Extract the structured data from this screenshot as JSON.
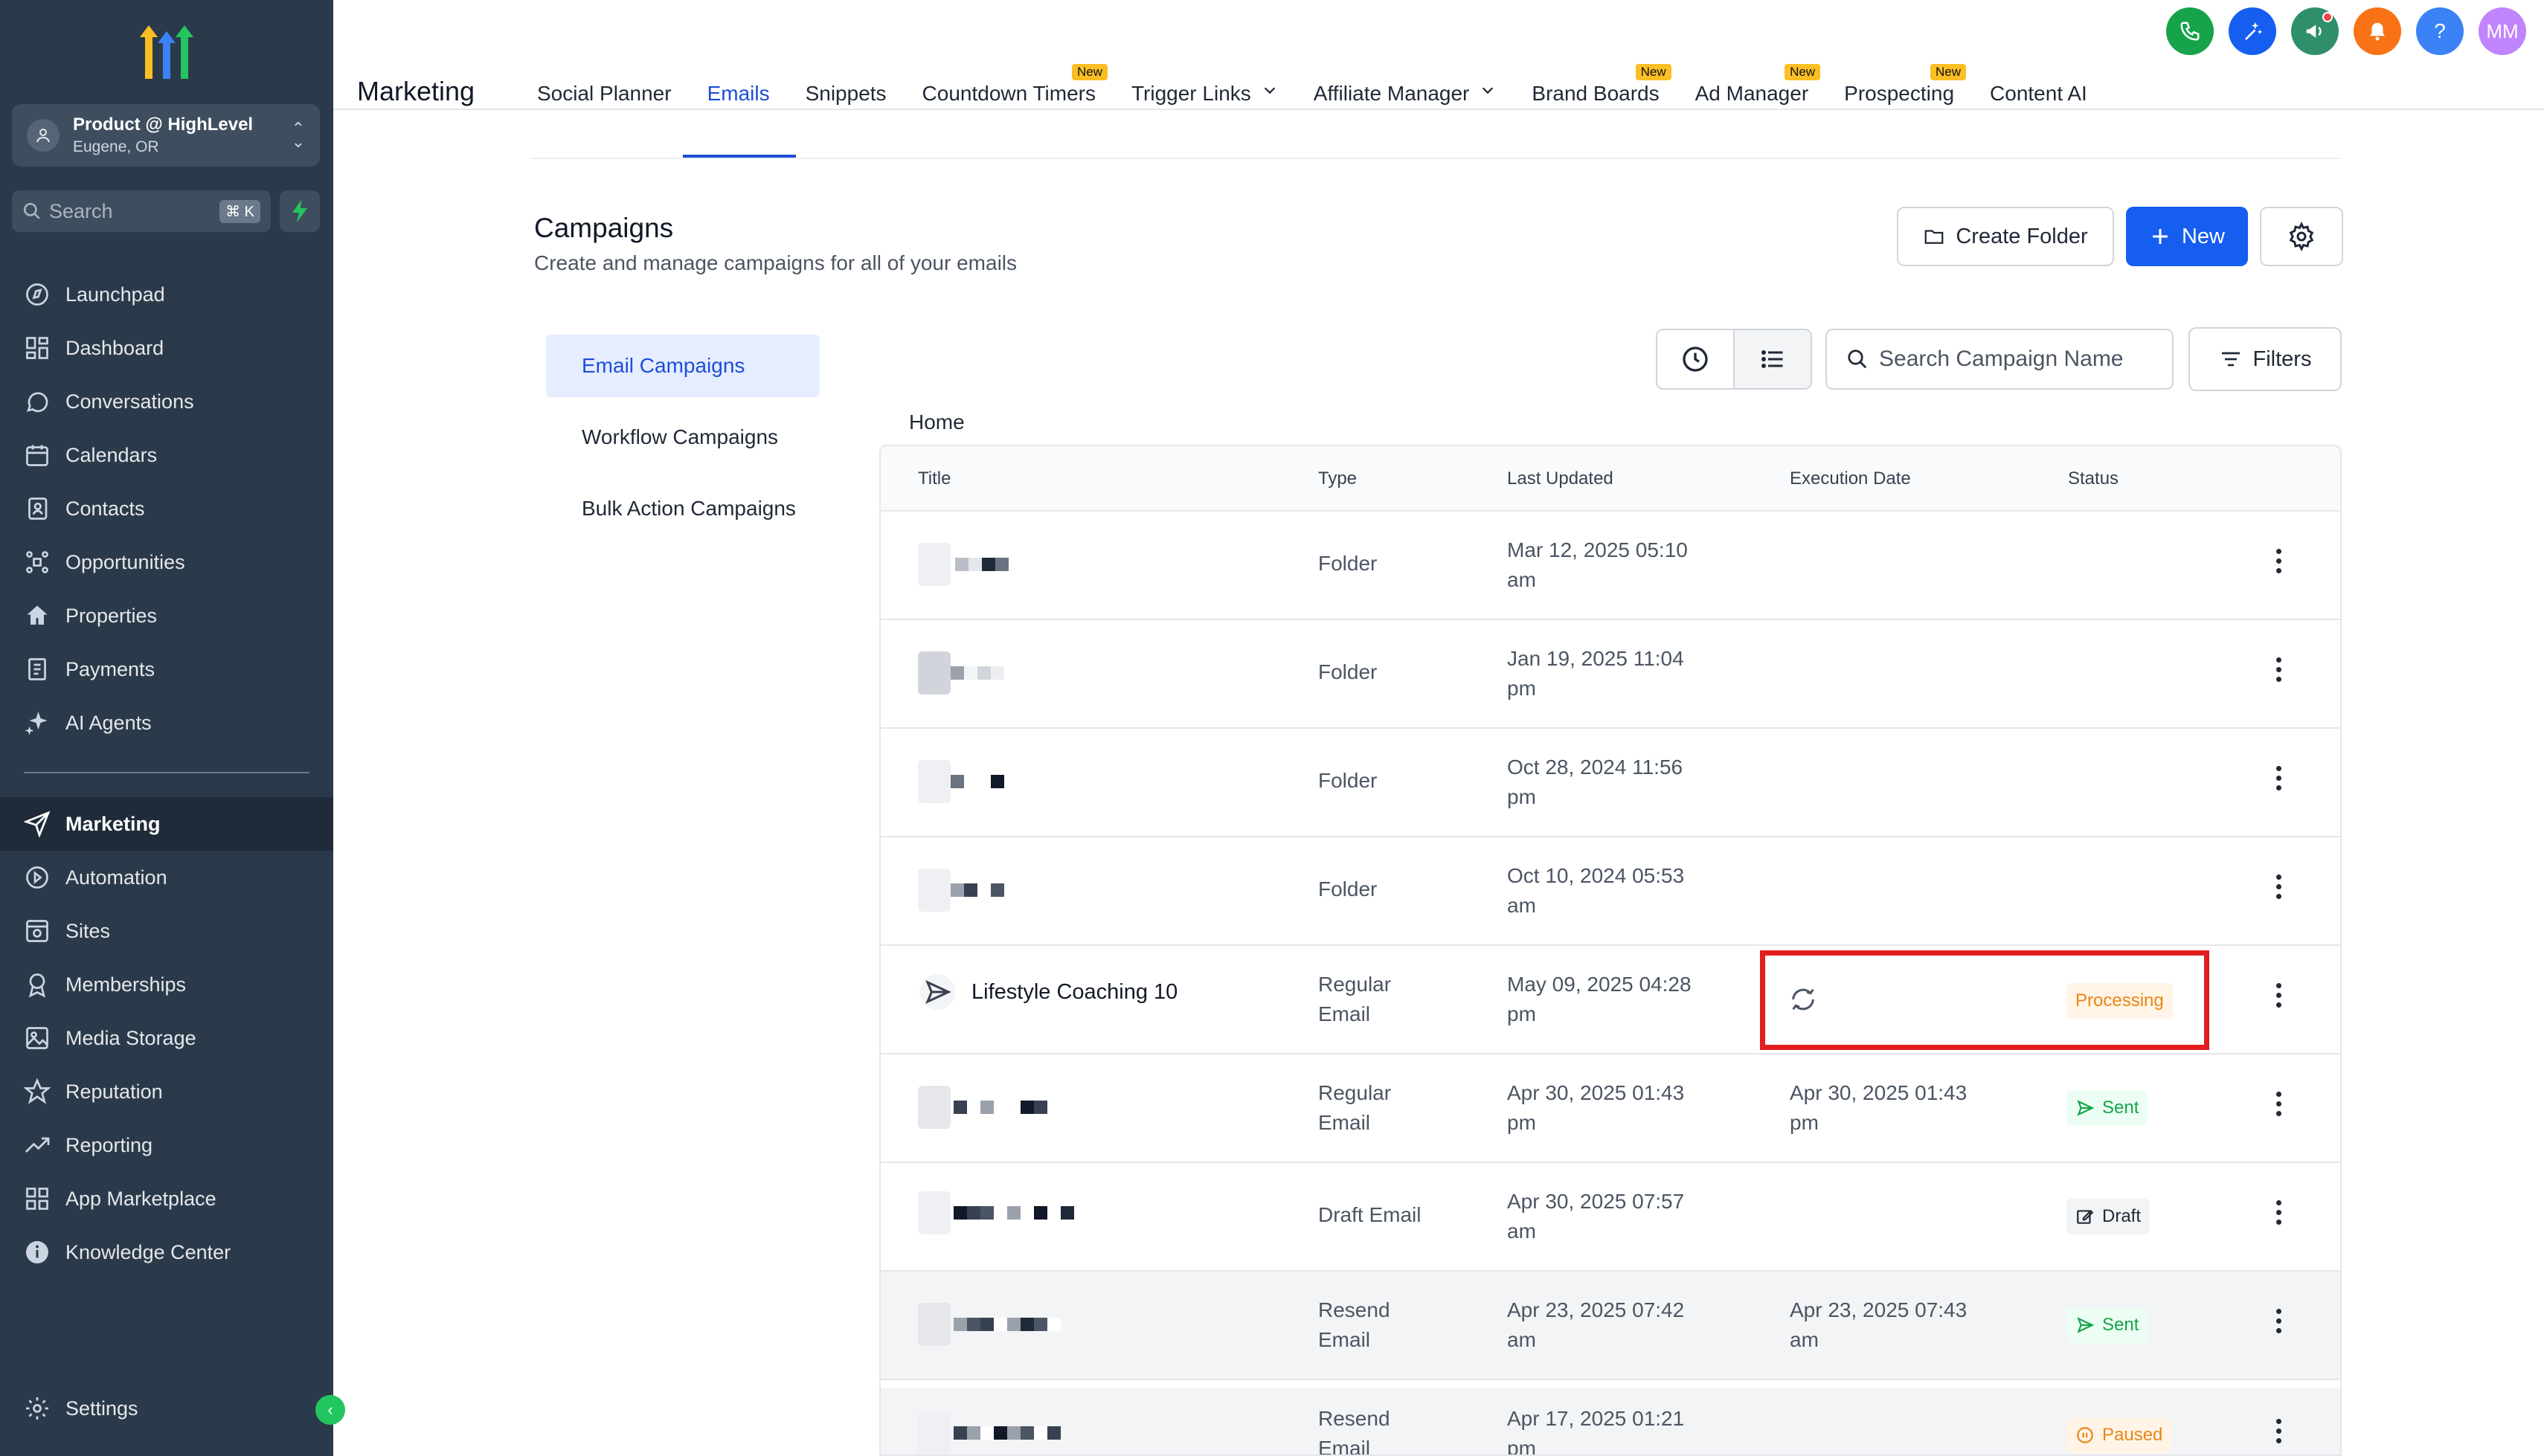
{
  "sidebar": {
    "account": {
      "name": "Product @ HighLevel",
      "location": "Eugene, OR"
    },
    "search": {
      "placeholder": "Search",
      "shortcut": "⌘ K"
    },
    "items": [
      {
        "label": "Launchpad",
        "icon": "launchpad-icon"
      },
      {
        "label": "Dashboard",
        "icon": "dashboard-icon"
      },
      {
        "label": "Conversations",
        "icon": "chat-icon"
      },
      {
        "label": "Calendars",
        "icon": "calendar-icon"
      },
      {
        "label": "Contacts",
        "icon": "contacts-icon"
      },
      {
        "label": "Opportunities",
        "icon": "opportunities-icon"
      },
      {
        "label": "Properties",
        "icon": "home-icon"
      },
      {
        "label": "Payments",
        "icon": "payments-icon"
      },
      {
        "label": "AI Agents",
        "icon": "sparkle-icon"
      }
    ],
    "items2": [
      {
        "label": "Marketing",
        "icon": "send-icon",
        "active": true
      },
      {
        "label": "Automation",
        "icon": "automation-icon"
      },
      {
        "label": "Sites",
        "icon": "sites-icon"
      },
      {
        "label": "Memberships",
        "icon": "membership-icon"
      },
      {
        "label": "Media Storage",
        "icon": "image-icon"
      },
      {
        "label": "Reputation",
        "icon": "star-icon"
      },
      {
        "label": "Reporting",
        "icon": "trend-icon"
      },
      {
        "label": "App Marketplace",
        "icon": "grid-icon"
      },
      {
        "label": "Knowledge Center",
        "icon": "info-icon"
      }
    ],
    "settings": "Settings"
  },
  "topbar": {
    "section_title": "Marketing",
    "tabs": [
      {
        "label": "Social Planner",
        "badge": "",
        "dropdown": false
      },
      {
        "label": "Emails",
        "badge": "",
        "dropdown": false,
        "active": true
      },
      {
        "label": "Snippets",
        "badge": "",
        "dropdown": false
      },
      {
        "label": "Countdown Timers",
        "badge": "New",
        "dropdown": false
      },
      {
        "label": "Trigger Links",
        "badge": "",
        "dropdown": true
      },
      {
        "label": "Affiliate Manager",
        "badge": "",
        "dropdown": true
      },
      {
        "label": "Brand Boards",
        "badge": "New",
        "dropdown": false
      },
      {
        "label": "Ad Manager",
        "badge": "New",
        "dropdown": false
      },
      {
        "label": "Prospecting",
        "badge": "New",
        "dropdown": false
      },
      {
        "label": "Content AI",
        "badge": "",
        "dropdown": false
      }
    ],
    "user_initials": "MM",
    "help": "?",
    "colors": {
      "phone": "#16a34a",
      "ai": "#155eef",
      "announce": "#2f8f6b",
      "bell": "#f97316",
      "help": "#3b82f6",
      "avatar": "#c084fc"
    }
  },
  "page": {
    "title": "Campaigns",
    "subtitle": "Create and manage campaigns for all of your emails",
    "create_folder": "Create Folder",
    "new": "New"
  },
  "subnav": [
    "Email Campaigns",
    "Workflow Campaigns",
    "Bulk Action Campaigns"
  ],
  "search": {
    "placeholder": "Search Campaign Name"
  },
  "filters": "Filters",
  "breadcrumb": "Home",
  "table": {
    "headers": {
      "title": "Title",
      "type": "Type",
      "updated": "Last Updated",
      "exec": "Execution Date",
      "status": "Status"
    },
    "rows": [
      {
        "title": "",
        "type": [
          "Folder"
        ],
        "updated": [
          "Mar 12, 2025 05:10",
          "am"
        ],
        "exec": [],
        "status": ""
      },
      {
        "title": "",
        "type": [
          "Folder"
        ],
        "updated": [
          "Jan 19, 2025 11:04",
          "pm"
        ],
        "exec": [],
        "status": ""
      },
      {
        "title": "",
        "type": [
          "Folder"
        ],
        "updated": [
          "Oct 28, 2024 11:56",
          "pm"
        ],
        "exec": [],
        "status": ""
      },
      {
        "title": "",
        "type": [
          "Folder"
        ],
        "updated": [
          "Oct 10, 2024 05:53",
          "am"
        ],
        "exec": [],
        "status": ""
      },
      {
        "title": "Lifestyle Coaching 10",
        "type": [
          "Regular",
          "Email"
        ],
        "updated": [
          "May 09, 2025 04:28",
          "pm"
        ],
        "exec": [],
        "status": "Processing"
      },
      {
        "title": "",
        "type": [
          "Regular",
          "Email"
        ],
        "updated": [
          "Apr 30, 2025 01:43",
          "pm"
        ],
        "exec": [
          "Apr 30, 2025 01:43",
          "pm"
        ],
        "status": "Sent"
      },
      {
        "title": "",
        "type": [
          "Draft Email"
        ],
        "updated": [
          "Apr 30, 2025 07:57",
          "am"
        ],
        "exec": [],
        "status": "Draft"
      },
      {
        "title": "",
        "type": [
          "Resend",
          "Email"
        ],
        "updated": [
          "Apr 23, 2025 07:42",
          "am"
        ],
        "exec": [
          "Apr 23, 2025 07:43",
          "am"
        ],
        "status": "Sent"
      },
      {
        "title": "",
        "type": [
          "Resend",
          "Email"
        ],
        "updated": [
          "Apr 17, 2025 01:21",
          "pm"
        ],
        "exec": [],
        "status": "Paused"
      }
    ]
  }
}
